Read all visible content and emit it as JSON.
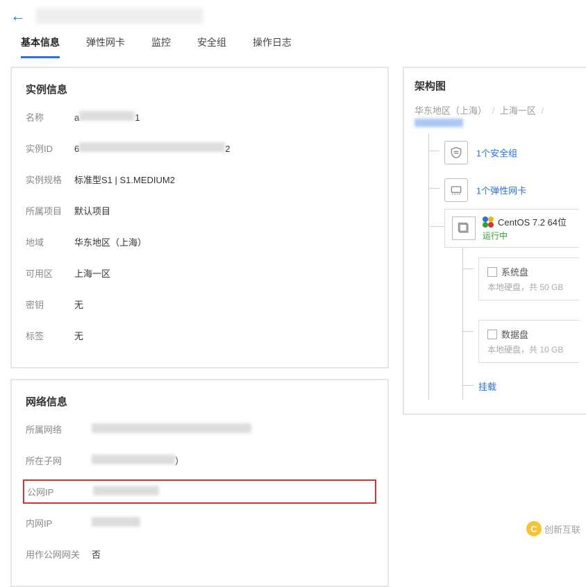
{
  "tabs": {
    "basic": "基本信息",
    "eni": "弹性网卡",
    "monitor": "监控",
    "security": "安全组",
    "oplog": "操作日志"
  },
  "instance_panel": {
    "title": "实例信息",
    "name_label": "名称",
    "name_prefix": "a",
    "name_suffix": "1",
    "id_label": "实例ID",
    "id_prefix": "6",
    "id_suffix": "2",
    "spec_label": "实例规格",
    "spec_value": "标准型S1 | S1.MEDIUM2",
    "project_label": "所属项目",
    "project_value": "默认项目",
    "region_label": "地域",
    "region_value": "华东地区（上海）",
    "zone_label": "可用区",
    "zone_value": "上海一区",
    "keypair_label": "密钥",
    "keypair_value": "无",
    "tag_label": "标签",
    "tag_value": "无"
  },
  "network_panel": {
    "title": "网络信息",
    "vpc_label": "所属网络",
    "subnet_label": "所在子网",
    "subnet_suffix": "）",
    "public_ip_label": "公网IP",
    "private_ip_label": "内网IP",
    "gateway_label": "用作公网网关",
    "gateway_value": "否"
  },
  "arch_panel": {
    "title": "架构图",
    "breadcrumb_region": "华东地区（上海）",
    "breadcrumb_zone": "上海一区",
    "sg_link": "1个安全组",
    "eni_link": "1个弹性网卡",
    "os_name": "CentOS 7.2 64位",
    "os_status": "运行中",
    "disk1_name": "系统盘",
    "disk1_desc": "本地硬盘，共 50 GB",
    "disk2_name": "数据盘",
    "disk2_desc": "本地硬盘，共 10 GB",
    "mount_link": "挂载"
  },
  "watermark": "创新互联"
}
